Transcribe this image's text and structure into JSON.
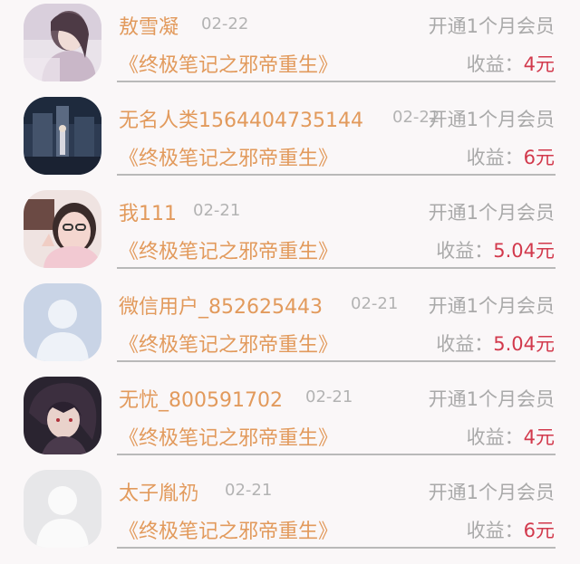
{
  "rows": [
    {
      "name": "敖雪凝",
      "date": "02-22",
      "plan": "开通1个月会员",
      "book": "《终极笔记之邪帝重生》",
      "earn_label": "收益：",
      "earn_value": "4元",
      "avatar": "photo-girl"
    },
    {
      "name": "无名人类1564404735144",
      "date": "02-22",
      "plan": "开通1个月会员",
      "book": "《终极笔记之邪帝重生》",
      "earn_label": "收益：",
      "earn_value": "6元",
      "avatar": "photo-scene"
    },
    {
      "name": "我111",
      "date": "02-21",
      "plan": "开通1个月会员",
      "book": "《终极笔记之邪帝重生》",
      "earn_label": "收益：",
      "earn_value": "5.04元",
      "avatar": "photo-selfie"
    },
    {
      "name": "微信用户_852625443",
      "date": "02-21",
      "plan": "开通1个月会员",
      "book": "《终极笔记之邪帝重生》",
      "earn_label": "收益：",
      "earn_value": "5.04元",
      "avatar": "default-user-blue"
    },
    {
      "name": "无忧_800591702",
      "date": "02-21",
      "plan": "开通1个月会员",
      "book": "《终极笔记之邪帝重生》",
      "earn_label": "收益：",
      "earn_value": "4元",
      "avatar": "anime-character"
    },
    {
      "name": "太子胤礽",
      "date": "02-21",
      "plan": "开通1个月会员",
      "book": "《终极笔记之邪帝重生》",
      "earn_label": "收益：",
      "earn_value": "6元",
      "avatar": "default-user-grey"
    }
  ],
  "colors": {
    "name": "#e29a5c",
    "muted": "#a9a9a9",
    "earning": "#d2394c",
    "divider": "#b9b9b9"
  }
}
